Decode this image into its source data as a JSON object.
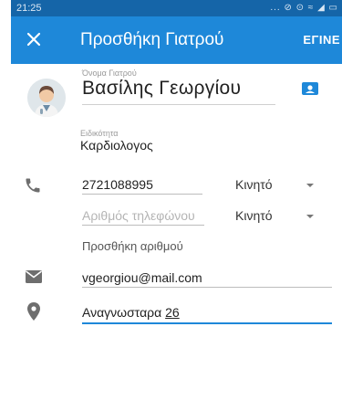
{
  "status_bar": {
    "time": "21:25",
    "icons": "... ⊘ ⊙ ≈ ◢ ▭"
  },
  "app_bar": {
    "title": "Προσθήκη Γιατρού",
    "done_label": "ΕΓΙΝΕ"
  },
  "doctor": {
    "name_label": "Όνομα Γιατρού",
    "name_value": "Βασίλης Γεωργίου",
    "specialty_label": "Ειδικότητα",
    "specialty_value": "Καρδιολογος"
  },
  "phones": [
    {
      "value": "2721088995",
      "type": "Κινητό"
    },
    {
      "placeholder": "Αριθμός τηλεφώνου",
      "type": "Κινητό"
    }
  ],
  "add_number_label": "Προσθήκη αριθμού",
  "email": {
    "value": "vgeorgiou@mail.com"
  },
  "address": {
    "prefix": "Αναγνωσταρα ",
    "number": "26"
  },
  "colors": {
    "app_bar": "#1e88d9",
    "status_bar": "#1565a8",
    "accent": "#1e88d9"
  }
}
